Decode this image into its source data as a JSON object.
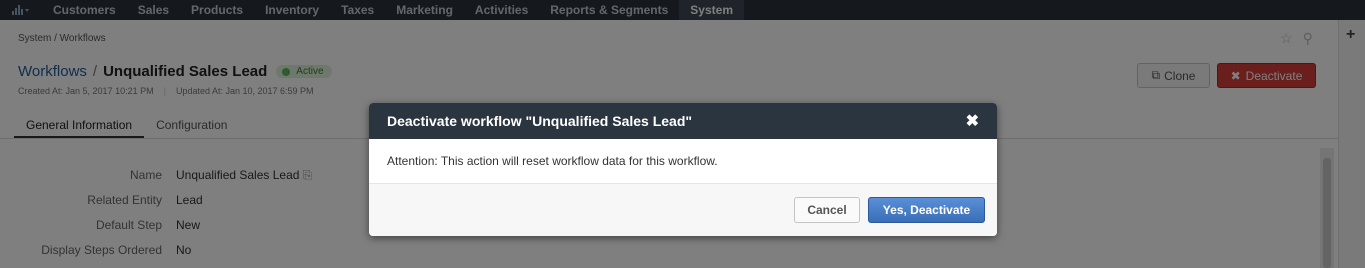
{
  "nav": {
    "chart_icon": "bar-chart-icon",
    "items": [
      "Customers",
      "Sales",
      "Products",
      "Inventory",
      "Taxes",
      "Marketing",
      "Activities",
      "Reports & Segments",
      "System"
    ],
    "active": "System"
  },
  "breadcrumb": "System / Workflows",
  "title": {
    "section_link": "Workflows",
    "separator": "/",
    "name": "Unqualified Sales Lead",
    "status": "Active"
  },
  "meta": {
    "created": "Created At: Jan 5, 2017 10:21 PM",
    "updated": "Updated At: Jan 10, 2017 6:59 PM"
  },
  "actions": {
    "clone_label": "Clone",
    "deactivate_label": "Deactivate"
  },
  "tabs": [
    "General Information",
    "Configuration"
  ],
  "fields": [
    {
      "label": "Name",
      "value": "Unqualified Sales Lead"
    },
    {
      "label": "Related Entity",
      "value": "Lead"
    },
    {
      "label": "Default Step",
      "value": "New"
    },
    {
      "label": "Display Steps Ordered",
      "value": "No"
    }
  ],
  "modal": {
    "title": "Deactivate workflow \"Unqualified Sales Lead\"",
    "message": "Attention: This action will reset workflow data for this workflow.",
    "cancel_label": "Cancel",
    "confirm_label": "Yes, Deactivate"
  },
  "rail": {
    "plus": "+"
  },
  "colors": {
    "nav_bg": "#2a323c",
    "link": "#1f5c99",
    "danger": "#d43f3a",
    "primary": "#3a6fb8",
    "active_badge": "#5cb85c"
  }
}
